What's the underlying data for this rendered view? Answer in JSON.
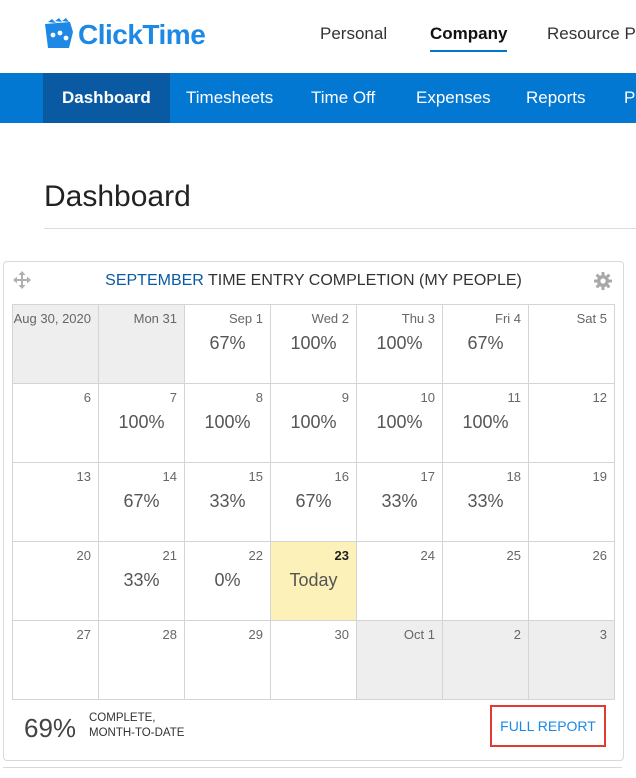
{
  "brand": {
    "name": "ClickTime",
    "color": "#1e88e5"
  },
  "top_nav": {
    "items": [
      {
        "label": "Personal",
        "active": false
      },
      {
        "label": "Company",
        "active": true
      },
      {
        "label": "Resource Pl",
        "active": false
      }
    ]
  },
  "main_nav": {
    "items": [
      {
        "label": "Dashboard",
        "active": true
      },
      {
        "label": "Timesheets",
        "active": false
      },
      {
        "label": "Time Off",
        "active": false
      },
      {
        "label": "Expenses",
        "active": false
      },
      {
        "label": "Reports",
        "active": false
      },
      {
        "label": "Pe",
        "active": false
      }
    ]
  },
  "page": {
    "title": "Dashboard"
  },
  "widget": {
    "title_month": "SEPTEMBER",
    "title_rest": " TIME ENTRY COMPLETION (MY PEOPLE)",
    "weeks": [
      [
        {
          "date": "Aug 30, 2020",
          "value": "",
          "outside": true
        },
        {
          "date": "Mon 31",
          "value": "",
          "outside": true
        },
        {
          "date": "Sep 1",
          "value": "67%"
        },
        {
          "date": "Wed 2",
          "value": "100%"
        },
        {
          "date": "Thu 3",
          "value": "100%"
        },
        {
          "date": "Fri 4",
          "value": "67%"
        },
        {
          "date": "Sat 5",
          "value": ""
        }
      ],
      [
        {
          "date": "6",
          "value": ""
        },
        {
          "date": "7",
          "value": "100%"
        },
        {
          "date": "8",
          "value": "100%"
        },
        {
          "date": "9",
          "value": "100%"
        },
        {
          "date": "10",
          "value": "100%"
        },
        {
          "date": "11",
          "value": "100%"
        },
        {
          "date": "12",
          "value": ""
        }
      ],
      [
        {
          "date": "13",
          "value": ""
        },
        {
          "date": "14",
          "value": "67%"
        },
        {
          "date": "15",
          "value": "33%"
        },
        {
          "date": "16",
          "value": "67%"
        },
        {
          "date": "17",
          "value": "33%"
        },
        {
          "date": "18",
          "value": "33%"
        },
        {
          "date": "19",
          "value": ""
        }
      ],
      [
        {
          "date": "20",
          "value": ""
        },
        {
          "date": "21",
          "value": "33%"
        },
        {
          "date": "22",
          "value": "0%"
        },
        {
          "date": "23",
          "value": "Today",
          "today": true
        },
        {
          "date": "24",
          "value": ""
        },
        {
          "date": "25",
          "value": ""
        },
        {
          "date": "26",
          "value": ""
        }
      ],
      [
        {
          "date": "27",
          "value": ""
        },
        {
          "date": "28",
          "value": ""
        },
        {
          "date": "29",
          "value": ""
        },
        {
          "date": "30",
          "value": ""
        },
        {
          "date": "Oct 1",
          "value": "",
          "outside": true
        },
        {
          "date": "2",
          "value": "",
          "outside": true
        },
        {
          "date": "3",
          "value": "",
          "outside": true
        }
      ]
    ],
    "summary_value": "69%",
    "summary_label_line1": "COMPLETE,",
    "summary_label_line2": "MONTH-TO-DATE",
    "full_report_label": "FULL REPORT",
    "icons": {
      "move": "move-icon",
      "settings": "gear-icon"
    }
  }
}
